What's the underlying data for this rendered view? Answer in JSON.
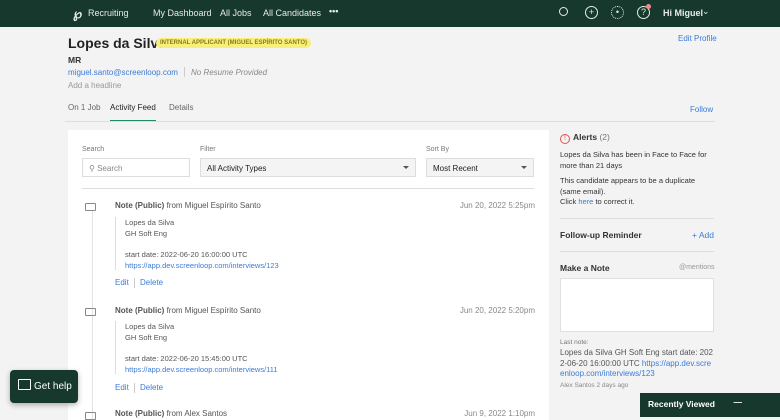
{
  "nav": {
    "app": "Recruiting",
    "links": [
      "My Dashboard",
      "All Jobs",
      "All Candidates"
    ],
    "more": "•••",
    "greeting": "Hi Miguel",
    "icons": [
      "search-icon",
      "plus-circle-icon",
      "gear-icon",
      "help-icon"
    ]
  },
  "profile": {
    "name": "Lopes da Silva",
    "badge": "INTERNAL APPLICANT (MIGUEL ESPÍRITO SANTO)",
    "initials": "MR",
    "email": "miguel.santo@screenloop.com",
    "resume": "No Resume Provided",
    "headline": "Add a headline",
    "edit": "Edit Profile",
    "follow": "Follow"
  },
  "tabs": [
    "On 1 Job",
    "Activity Feed",
    "Details"
  ],
  "filters": {
    "search_label": "Search",
    "search_placeholder": "Search",
    "filter_label": "Filter",
    "filter_value": "All Activity Types",
    "sort_label": "Sort By",
    "sort_value": "Most Recent"
  },
  "notes": [
    {
      "title": "Note (Public)",
      "from": "from Miguel Espírito Santo",
      "date": "Jun 20, 2022 5:25pm",
      "l1": "Lopes da Silva",
      "l2": "GH Soft Eng",
      "l3": "start date: 2022-06-20 16:00:00 UTC",
      "link": "https://app.dev.screenloop.com/interviews/123",
      "edit": "Edit",
      "delete": "Delete"
    },
    {
      "title": "Note (Public)",
      "from": "from Miguel Espírito Santo",
      "date": "Jun 20, 2022 5:20pm",
      "l1": "Lopes da Silva",
      "l2": "GH Soft Eng",
      "l3": "start date: 2022-06-20 15:45:00 UTC",
      "link": "https://app.dev.screenloop.com/interviews/111",
      "edit": "Edit",
      "delete": "Delete"
    },
    {
      "title": "Note (Public)",
      "from": "from Alex Santos",
      "date": "Jun 9, 2022 1:10pm"
    }
  ],
  "alerts": {
    "title": "Alerts",
    "count": "(2)",
    "a1": "Lopes da Silva has been in Face to Face for more than 21 days",
    "a2": "This candidate appears to be a duplicate (same email).",
    "a3_pre": "Click",
    "a3_link": "here",
    "a3_post": "to correct it."
  },
  "followup": {
    "title": "Follow-up Reminder",
    "add": "+ Add"
  },
  "make_note": {
    "title": "Make a Note",
    "mentions": "@mentions",
    "last_label": "Last note:",
    "last_text": "Lopes da Silva GH Soft Eng start date: 2022-06-20 16:00:00 UTC",
    "last_link": "https://app.dev.screenloop.com/interviews/123",
    "author": "Alex Santos 2 days ago"
  },
  "help": "Get help",
  "recent": "Recently Viewed"
}
